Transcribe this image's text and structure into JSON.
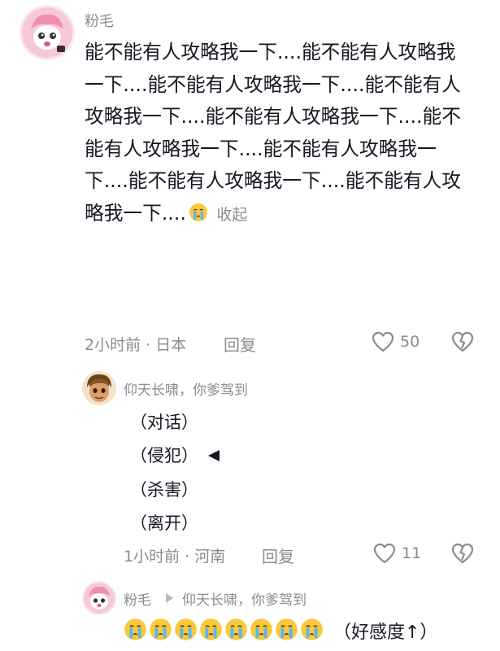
{
  "comments": [
    {
      "username": "粉毛",
      "text": "能不能有人攻略我一下....能不能有人攻略我一下....能不能有人攻略我一下....能不能有人攻略我一下....能不能有人攻略我一下....能不能有人攻略我一下....能不能有人攻略我一下....能不能有人攻略我一下....能不能有人攻略我一下....",
      "text_emoji": "loudly-crying-face",
      "collapse_label": "收起",
      "meta": "2小时前 · 日本",
      "reply_label": "回复",
      "like_count": "50"
    },
    {
      "username": "仰天长啸，你爹驾到",
      "options": [
        "（对话）",
        "（侵犯）",
        "（杀害）",
        "（离开）"
      ],
      "selected_option_index": 1,
      "meta": "1小时前 · 河南",
      "reply_label": "回复",
      "like_count": "11"
    },
    {
      "username": "粉毛",
      "reply_to": "仰天长啸，你爹驾到",
      "emoji": "loudly-crying-face",
      "emoji_count": 8,
      "text": "（好感度↑）"
    }
  ],
  "colors": {
    "text": "#161823",
    "secondary": "#8a8b91",
    "background": "#ffffff",
    "avatar_pink": "#f6c9d8"
  }
}
